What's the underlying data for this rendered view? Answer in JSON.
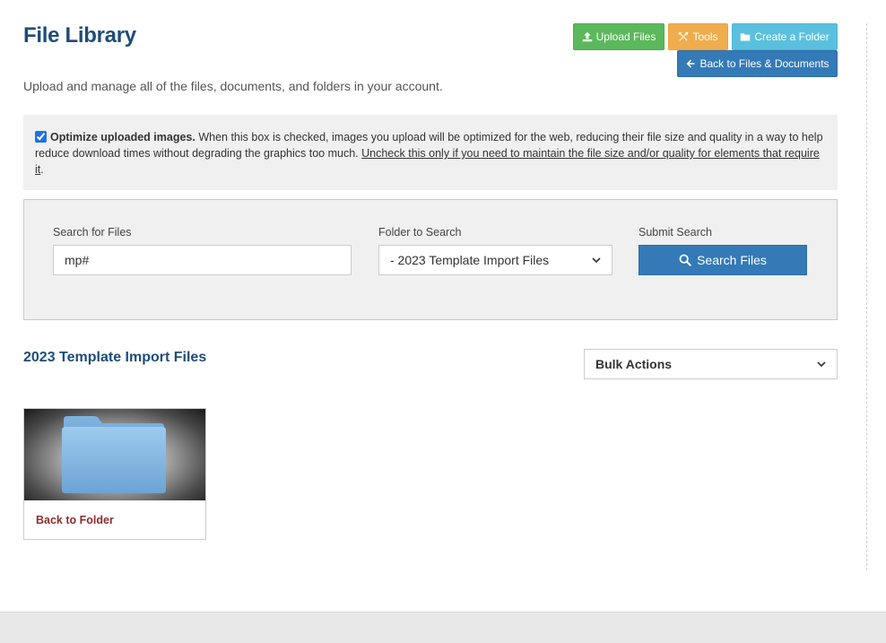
{
  "header": {
    "title": "File Library",
    "subtitle": "Upload and manage all of the files, documents, and folders in your account."
  },
  "toolbar": {
    "upload_label": "Upload Files",
    "tools_label": "Tools",
    "create_folder_label": "Create a Folder",
    "back_label": "Back to Files & Documents"
  },
  "optimize": {
    "checked": true,
    "bold_label": "Optimize uploaded images.",
    "description": " When this box is checked, images you upload will be optimized for the web, reducing their file size and quality in a way to help reduce download times without degrading the graphics too much. ",
    "underline_text": "Uncheck this only if you need to maintain the file size and/or quality for elements that require it",
    "end_punct": "."
  },
  "search": {
    "search_label": "Search for Files",
    "search_value": "mp#",
    "folder_label": "Folder to Search",
    "folder_selected": "- 2023 Template Import Files",
    "submit_label": "Submit Search",
    "submit_button": "Search Files"
  },
  "section": {
    "title": "2023 Template Import Files",
    "bulk_actions": "Bulk Actions"
  },
  "folder_card": {
    "link_label": "Back to Folder"
  },
  "icons": {
    "upload": "upload-icon",
    "tools": "wrench-icon",
    "folder": "folder-icon",
    "back": "arrow-left-icon",
    "search": "search-icon",
    "caret": "chevron-down-icon"
  },
  "colors": {
    "title": "#1e4d78",
    "upload": "#5cb85c",
    "tools": "#f0ad4e",
    "create_folder": "#5bc0de",
    "primary": "#337ab7",
    "link": "#8b2e2e"
  }
}
